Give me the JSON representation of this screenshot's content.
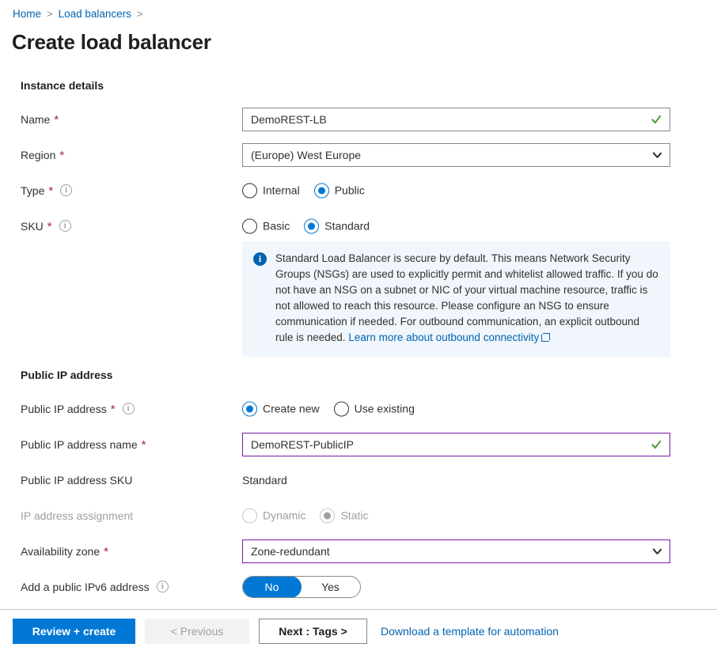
{
  "breadcrumb": {
    "items": [
      {
        "label": "Home"
      },
      {
        "label": "Load balancers"
      }
    ],
    "separator": ">"
  },
  "page_title": "Create load balancer",
  "instance_details": {
    "heading": "Instance details",
    "name": {
      "label": "Name",
      "required": "*",
      "value": "DemoREST-LB",
      "validation_icon": "checkmark-icon"
    },
    "region": {
      "label": "Region",
      "required": "*",
      "value": "(Europe) West Europe",
      "chevron_icon": "chevron-down-icon"
    },
    "type": {
      "label": "Type",
      "required": "*",
      "info_icon": "info-icon",
      "options": [
        {
          "label": "Internal",
          "selected": false
        },
        {
          "label": "Public",
          "selected": true
        }
      ]
    },
    "sku": {
      "label": "SKU",
      "required": "*",
      "info_icon": "info-icon",
      "options": [
        {
          "label": "Basic",
          "selected": false
        },
        {
          "label": "Standard",
          "selected": true
        }
      ]
    }
  },
  "banner": {
    "icon": "info-filled-icon",
    "text": "Standard Load Balancer is secure by default.  This means Network Security Groups (NSGs) are used to explicitly permit and whitelist allowed traffic. If you do not have an NSG on a subnet or NIC of your virtual machine resource, traffic is not allowed to reach this resource. Please configure an NSG to ensure communication if needed.  For outbound communication, an explicit outbound rule is needed. ",
    "link_text": "Learn more about outbound connectivity",
    "link_icon": "external-link-icon",
    "background": "#f0f6fc",
    "accent": "#0063b1"
  },
  "public_ip": {
    "heading": "Public IP address",
    "public_ip_address": {
      "label": "Public IP address",
      "required": "*",
      "info_icon": "info-icon",
      "options": [
        {
          "label": "Create new",
          "selected": true
        },
        {
          "label": "Use existing",
          "selected": false
        }
      ]
    },
    "public_ip_name": {
      "label": "Public IP address name",
      "required": "*",
      "value": "DemoREST-PublicIP",
      "validation_icon": "checkmark-icon"
    },
    "public_ip_sku": {
      "label": "Public IP address SKU",
      "value": "Standard"
    },
    "ip_assignment": {
      "label": "IP address assignment",
      "disabled": true,
      "options": [
        {
          "label": "Dynamic",
          "selected": false
        },
        {
          "label": "Static",
          "selected": true
        }
      ]
    },
    "availability_zone": {
      "label": "Availability zone",
      "required": "*",
      "value": "Zone-redundant",
      "chevron_icon": "chevron-down-icon"
    },
    "ipv6": {
      "label": "Add a public IPv6 address",
      "info_icon": "info-icon",
      "options": [
        {
          "label": "No",
          "selected": true
        },
        {
          "label": "Yes",
          "selected": false
        }
      ]
    }
  },
  "footer": {
    "review_create": "Review + create",
    "previous": "< Previous",
    "next": "Next : Tags >",
    "download_template": "Download a template for automation"
  },
  "colors": {
    "accent_blue": "#0078d4",
    "link_blue": "#0063b1",
    "required_red": "#a4262c",
    "field_accent_purple": "#7719aa",
    "valid_green": "#4f9b30"
  }
}
